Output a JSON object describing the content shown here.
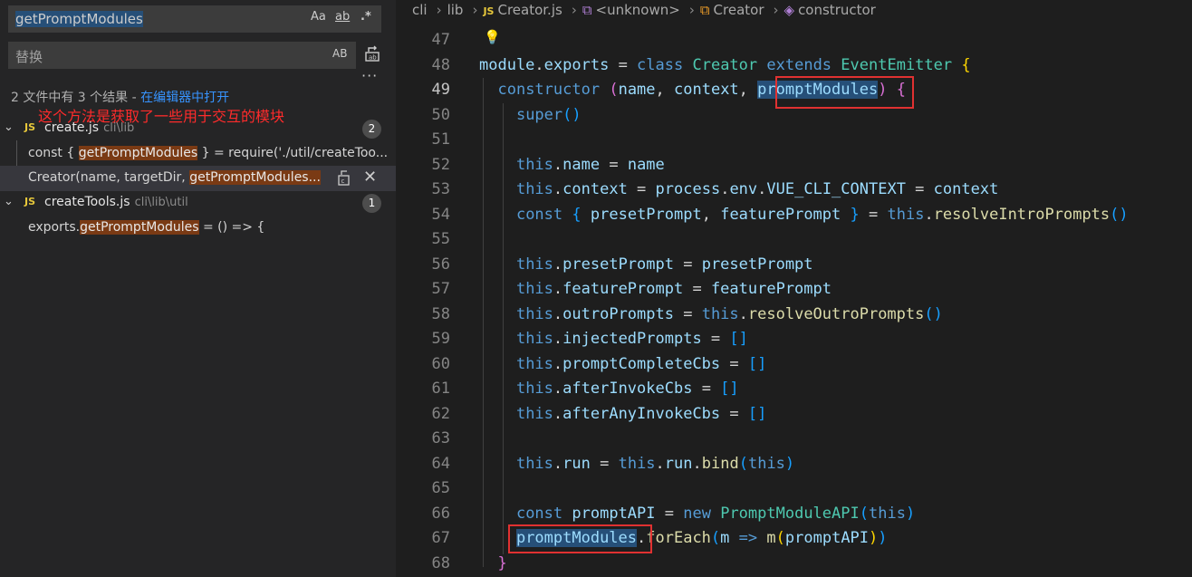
{
  "search": {
    "find_value": "getPromptModules",
    "replace_placeholder": "替换",
    "match_case_label": "Aa",
    "whole_word_label": "ab",
    "regex_label": ".*",
    "preserve_case_label": "AB",
    "more_label": "···"
  },
  "results": {
    "summary_prefix": "2 文件中有 3 个结果 - ",
    "summary_link": "在编辑器中打开",
    "annotation": "这个方法是获取了一些用于交互的模块",
    "files": [
      {
        "name": "create.js",
        "path": "cli\\lib",
        "count": "2",
        "matches": [
          {
            "before": "const { ",
            "hit": "getPromptModules",
            "after": " } = require('./util/createToo..."
          },
          {
            "before": "Creator(name, targetDir, ",
            "hit": "getPromptModules...",
            "after": ""
          }
        ]
      },
      {
        "name": "createTools.js",
        "path": "cli\\lib\\util",
        "count": "1",
        "matches": [
          {
            "before": "exports.",
            "hit": "getPromptModules",
            "after": " = () => {"
          }
        ]
      }
    ]
  },
  "breadcrumb": {
    "root": "cli",
    "folder": "lib",
    "js_label": "JS",
    "file": "Creator.js",
    "unknown": "<unknown>",
    "class": "Creator",
    "member": "constructor"
  },
  "code": {
    "line_numbers": [
      "47",
      "48",
      "49",
      "50",
      "51",
      "52",
      "53",
      "54",
      "55",
      "56",
      "57",
      "58",
      "59",
      "60",
      "61",
      "62",
      "63",
      "64",
      "65",
      "66",
      "67",
      "68"
    ],
    "active_line": "49"
  },
  "colors": {
    "annotation": "#ff2b2b",
    "highlight_box": "#e03131",
    "match_background": "#7a3a14",
    "selection": "#264f78"
  }
}
